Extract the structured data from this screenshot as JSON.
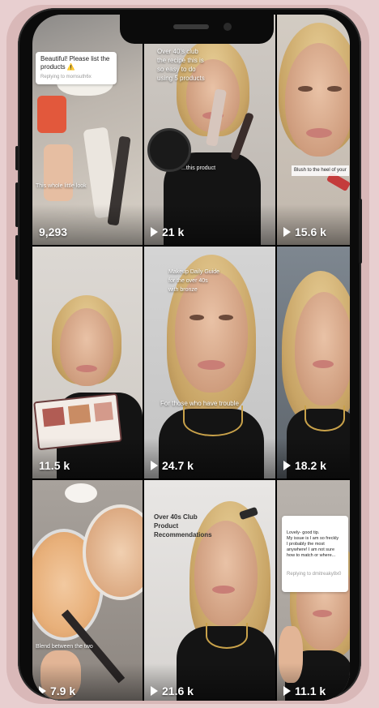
{
  "tiles": [
    {
      "views": "9,293",
      "play": false,
      "bubble": {
        "text": "Beautiful! Please list the products ⚠️",
        "sub": "Replying to momsuth6x"
      },
      "caption": "This whole little look"
    },
    {
      "views": "21 k",
      "play": true,
      "caption": "Over 40's club\nthe recipe this is\nso easy to do\nusing 5 products",
      "caption2": "...this product"
    },
    {
      "views": "15.6 k",
      "play": true,
      "caption": "Blush to the heel of your"
    },
    {
      "views": "11.5 k",
      "play": true
    },
    {
      "views": "24.7 k",
      "play": true,
      "caption": "Makeup Daily Guide\nfor the over 40s\nwith bronze",
      "caption2": "For those who have trouble"
    },
    {
      "views": "18.2 k",
      "play": true
    },
    {
      "views": "7.9 k",
      "play": true,
      "caption": "Blend between the two"
    },
    {
      "views": "21.6 k",
      "play": true,
      "caption": "Over 40s Club\nProduct\nRecommendations"
    },
    {
      "views": "11.1 k",
      "play": true,
      "bubble": {
        "text": "Lovely- good tip.\nMy issue is I am so freckly\nI probably the most\nanywhere! I am not sure\nhow to match or where...",
        "sub": "Replying to dmitreaky8x0"
      }
    }
  ],
  "colors": {
    "accent": "#ffffff",
    "bubble": "#ffffff"
  }
}
